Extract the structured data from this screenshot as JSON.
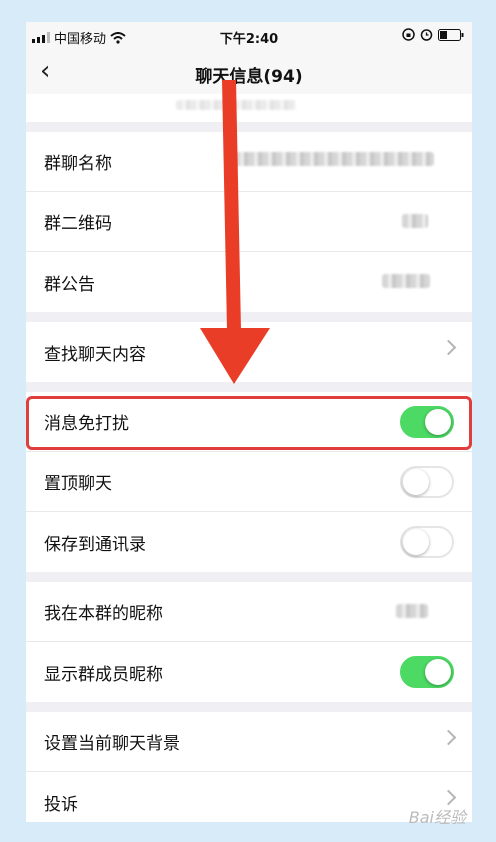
{
  "status_bar": {
    "carrier": "中国移动",
    "time": "下午2:40"
  },
  "nav": {
    "title": "聊天信息(94)"
  },
  "group_info": {
    "items": [
      {
        "label": "群聊名称"
      },
      {
        "label": "群二维码"
      },
      {
        "label": "群公告"
      }
    ]
  },
  "search_section": {
    "label": "查找聊天内容"
  },
  "settings": {
    "items": [
      {
        "label": "消息免打扰",
        "toggle": true
      },
      {
        "label": "置顶聊天",
        "toggle": false
      },
      {
        "label": "保存到通讯录",
        "toggle": false
      }
    ]
  },
  "nickname_section": {
    "items": [
      {
        "label": "我在本群的昵称"
      },
      {
        "label": "显示群成员昵称",
        "toggle": true
      }
    ]
  },
  "bottom_section": {
    "items": [
      {
        "label": "设置当前聊天背景"
      },
      {
        "label": "投诉"
      }
    ]
  },
  "watermark": "Bai经验",
  "colors": {
    "toggle_on": "#4cd964",
    "annotation_red": "#e03d3d"
  }
}
